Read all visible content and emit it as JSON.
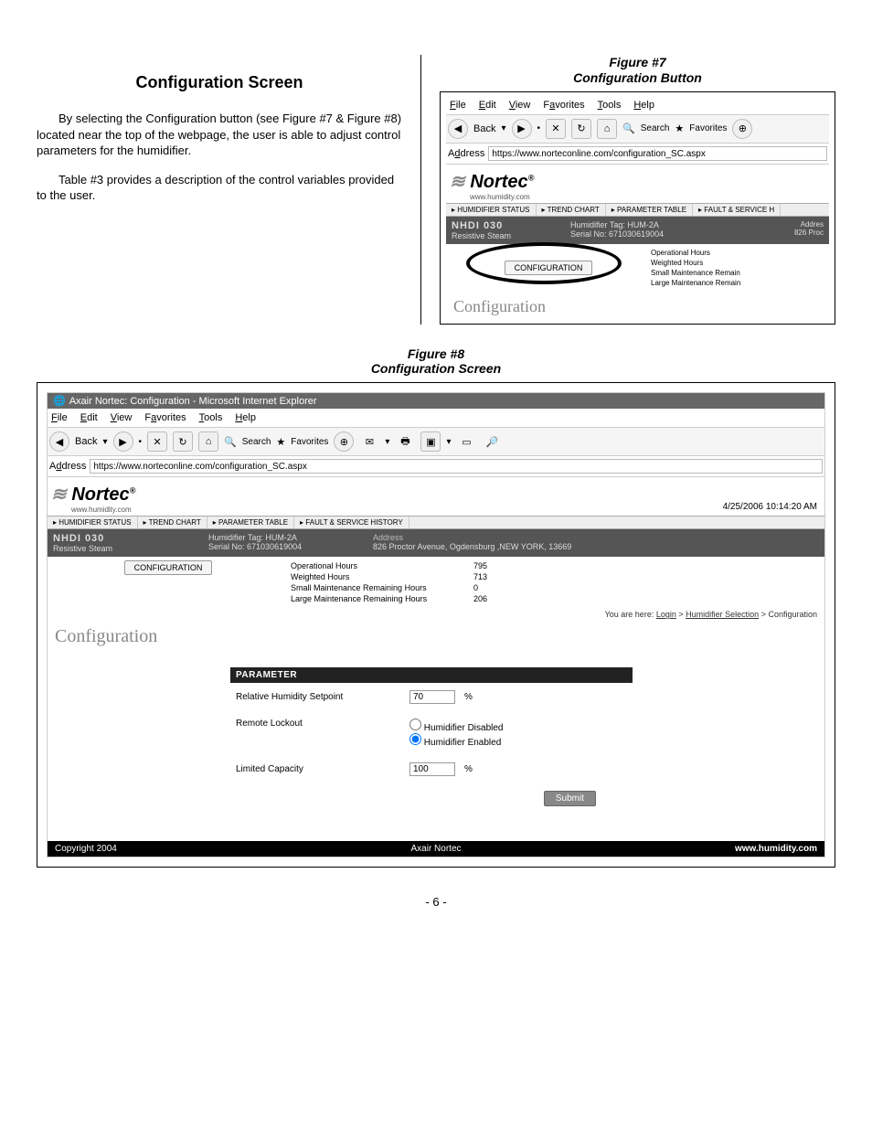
{
  "section": {
    "title": "Configuration Screen",
    "para1": "By selecting the Configuration button (see Figure #7 & Figure #8) located near the top of the webpage, the user is able to adjust control parameters for the humidifier.",
    "para2": "Table #3 provides a description of the control variables provided to the user."
  },
  "fig7": {
    "caption1": "Figure #7",
    "caption2": "Configuration Button",
    "menubar": {
      "file": "File",
      "edit": "Edit",
      "view": "View",
      "favorites": "Favorites",
      "tools": "Tools",
      "help": "Help"
    },
    "toolbar": {
      "back": "Back",
      "search": "Search",
      "favorites": "Favorites"
    },
    "addr_label": "Address",
    "addr_url": "https://www.norteconline.com/configuration_SC.aspx",
    "logo": "Nortec",
    "logo_sub": "www.humidity.com",
    "navtabs": [
      "▸ HUMIDIFIER STATUS",
      "▸ TREND CHART",
      "▸ PARAMETER TABLE",
      "▸ FAULT & SERVICE H"
    ],
    "hdr": {
      "model": "NHDI 030",
      "type": "Resistive Steam",
      "tag_lbl": "Humidifier Tag:",
      "tag_val": "HUM-2A",
      "serial_lbl": "Serial No:",
      "serial_val": "671030619004",
      "addr_lbl": "Addres",
      "addr_val": "826 Proc"
    },
    "config_btn": "CONFIGURATION",
    "stats": [
      "Operational Hours",
      "Weighted Hours",
      "Small Maintenance Remain",
      "Large Maintenance Remain"
    ],
    "config_heading": "Configuration"
  },
  "fig8": {
    "caption1": "Figure #8",
    "caption2": "Configuration Screen",
    "titlebar": "Axair Nortec: Configuration - Microsoft Internet Explorer",
    "menubar": {
      "file": "File",
      "edit": "Edit",
      "view": "View",
      "favorites": "Favorites",
      "tools": "Tools",
      "help": "Help"
    },
    "toolbar": {
      "back": "Back",
      "search": "Search",
      "favorites": "Favorites"
    },
    "addr_label": "Address",
    "addr_url": "https://www.norteconline.com/configuration_SC.aspx",
    "logo": "Nortec",
    "logo_sub": "www.humidity.com",
    "timestamp": "4/25/2006 10:14:20 AM",
    "navtabs": [
      "▸ HUMIDIFIER STATUS",
      "▸ TREND CHART",
      "▸ PARAMETER TABLE",
      "▸ FAULT & SERVICE HISTORY"
    ],
    "hdr": {
      "model": "NHDI 030",
      "type": "Resistive Steam",
      "tag_lbl": "Humidifier Tag:",
      "tag_val": "HUM-2A",
      "serial_lbl": "Serial No:",
      "serial_val": "671030619004",
      "addr_lbl": "Address",
      "addr_val": "826 Proctor Avenue, Ogdensburg ,NEW YORK, 13669"
    },
    "config_btn": "CONFIGURATION",
    "stats": [
      {
        "label": "Operational Hours",
        "value": "795"
      },
      {
        "label": "Weighted Hours",
        "value": "713"
      },
      {
        "label": "Small Maintenance Remaining Hours",
        "value": "0"
      },
      {
        "label": "Large Maintenance Remaining Hours",
        "value": "206"
      }
    ],
    "breadcrumb": {
      "prefix": "You are here:",
      "login": "Login",
      "sel": "Humidifier Selection",
      "cur": "Configuration"
    },
    "config_heading": "Configuration",
    "param_head": "PARAMETER",
    "params": {
      "rh_label": "Relative Humidity Setpoint",
      "rh_value": "70",
      "rh_unit": "%",
      "remote_label": "Remote Lockout",
      "remote_disabled": "Humidifier Disabled",
      "remote_enabled": "Humidifier Enabled",
      "cap_label": "Limited Capacity",
      "cap_value": "100",
      "cap_unit": "%"
    },
    "submit": "Submit",
    "footer": {
      "left": "Copyright 2004",
      "mid": "Axair Nortec",
      "right": "www.humidity.com"
    }
  },
  "page_number": "- 6 -"
}
